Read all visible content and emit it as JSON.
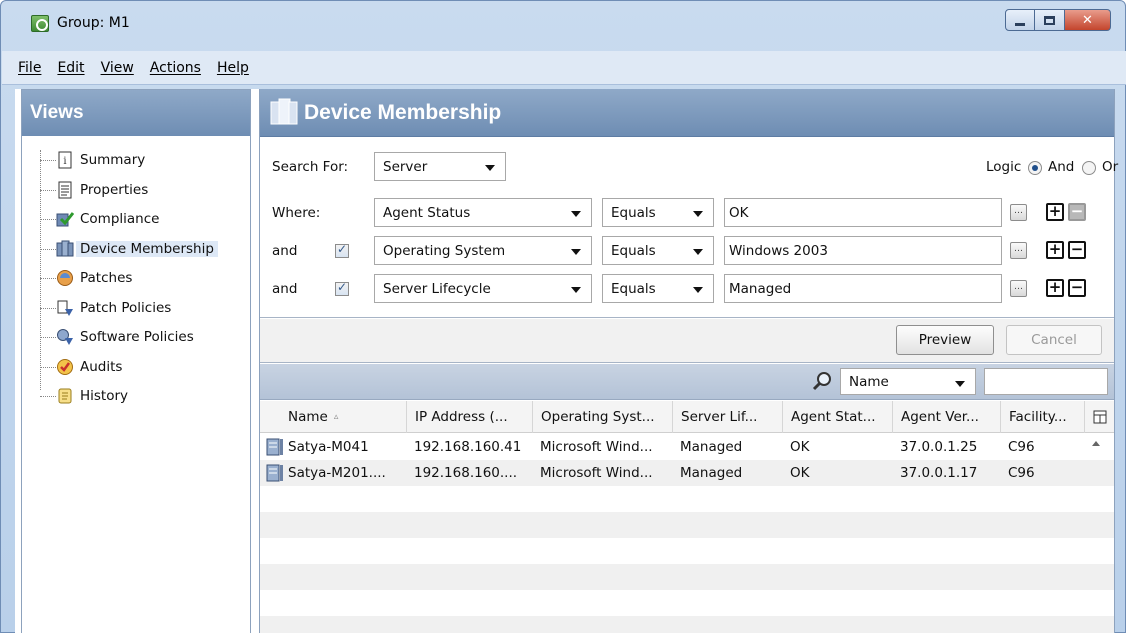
{
  "window": {
    "title": "Group: M1",
    "close_glyph": "✕"
  },
  "menu": [
    "File",
    "Edit",
    "View",
    "Actions",
    "Help"
  ],
  "views": {
    "header": "Views",
    "items": [
      {
        "label": "Summary",
        "icon": "summary-icon"
      },
      {
        "label": "Properties",
        "icon": "properties-icon"
      },
      {
        "label": "Compliance",
        "icon": "compliance-icon"
      },
      {
        "label": "Device Membership",
        "icon": "device-membership-icon",
        "selected": true
      },
      {
        "label": "Patches",
        "icon": "patches-icon"
      },
      {
        "label": "Patch Policies",
        "icon": "patch-policies-icon"
      },
      {
        "label": "Software Policies",
        "icon": "software-policies-icon"
      },
      {
        "label": "Audits",
        "icon": "audits-icon"
      },
      {
        "label": "History",
        "icon": "history-icon"
      }
    ]
  },
  "main": {
    "title": "Device Membership",
    "search_for_label": "Search For:",
    "search_for_value": "Server",
    "logic_label": "Logic",
    "logic_and": "And",
    "logic_or": "Or",
    "logic_selected": "And",
    "where_label": "Where:",
    "and_label": "and",
    "rules": [
      {
        "attribute": "Agent Status",
        "operator": "Equals",
        "value": "OK"
      },
      {
        "attribute": "Operating System",
        "operator": "Equals",
        "value": "Windows 2003"
      },
      {
        "attribute": "Server Lifecycle",
        "operator": "Equals",
        "value": "Managed"
      }
    ],
    "ellipsis_glyph": "…",
    "plus_glyph": "+",
    "minus_glyph": "−",
    "preview_label": "Preview",
    "cancel_label": "Cancel",
    "filter_field": "Name",
    "filter_value": ""
  },
  "table": {
    "columns": [
      "Name",
      "IP Address (...",
      "Operating Syst...",
      "Server Lif...",
      "Agent Stat...",
      "Agent Ver...",
      "Facility..."
    ],
    "sort_glyph": "▵",
    "rows": [
      [
        "Satya-M041",
        "192.168.160.41",
        "Microsoft Wind...",
        "Managed",
        "OK",
        "37.0.0.1.25",
        "C96"
      ],
      [
        "Satya-M201....",
        "192.168.160....",
        "Microsoft Wind...",
        "Managed",
        "OK",
        "37.0.0.1.17",
        "C96"
      ]
    ]
  },
  "colors": {
    "header_blue": "#7b98bd",
    "accent": "#1f4e8a"
  }
}
